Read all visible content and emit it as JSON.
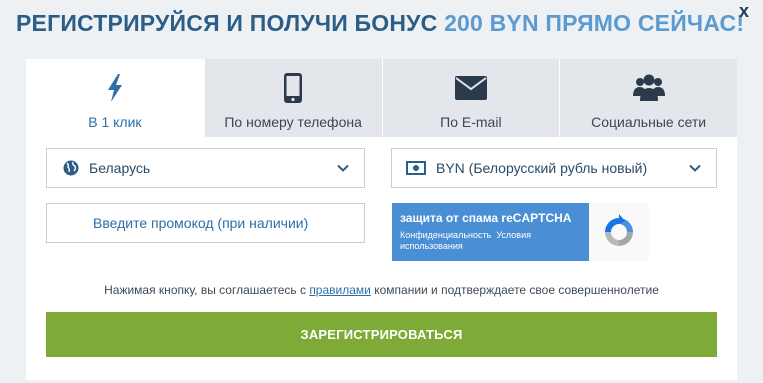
{
  "header": {
    "title_main": "РЕГИСТРИРУЙСЯ И ПОЛУЧИ БОНУС ",
    "title_accent": "200 BYN ПРЯМО СЕЙЧАС!",
    "close_symbol": "x"
  },
  "tabs": [
    {
      "label": "В 1 клик",
      "icon": "lightning-icon",
      "active": true
    },
    {
      "label": "По номеру телефона",
      "icon": "mobile-phone-icon",
      "active": false
    },
    {
      "label": "По E-mail",
      "icon": "envelope-icon",
      "active": false
    },
    {
      "label": "Социальные сети",
      "icon": "users-group-icon",
      "active": false
    }
  ],
  "form": {
    "country": {
      "value": "Беларусь",
      "icon": "globe-icon"
    },
    "currency": {
      "value": "BYN (Белорусский рубль новый)",
      "icon": "banknote-icon"
    },
    "promo": {
      "placeholder": "Введите промокод (при наличии)"
    }
  },
  "recaptcha": {
    "title": "защита от спама reCAPTCHA",
    "privacy": "Конфиденциальность",
    "terms": "Условия использования"
  },
  "terms": {
    "before": "Нажимая кнопку, вы соглашаетесь с ",
    "link": "правилами",
    "after": " компании и подтверждаете свое совершеннолетие"
  },
  "register_button": "ЗАРЕГИСТРИРОВАТЬСЯ",
  "colors": {
    "title": "#2c5d87",
    "title_accent": "#5b9bd0",
    "active_tab_text": "#2e6fa8",
    "register_button": "#7eab37",
    "recaptcha_badge": "#4a8fd6"
  }
}
